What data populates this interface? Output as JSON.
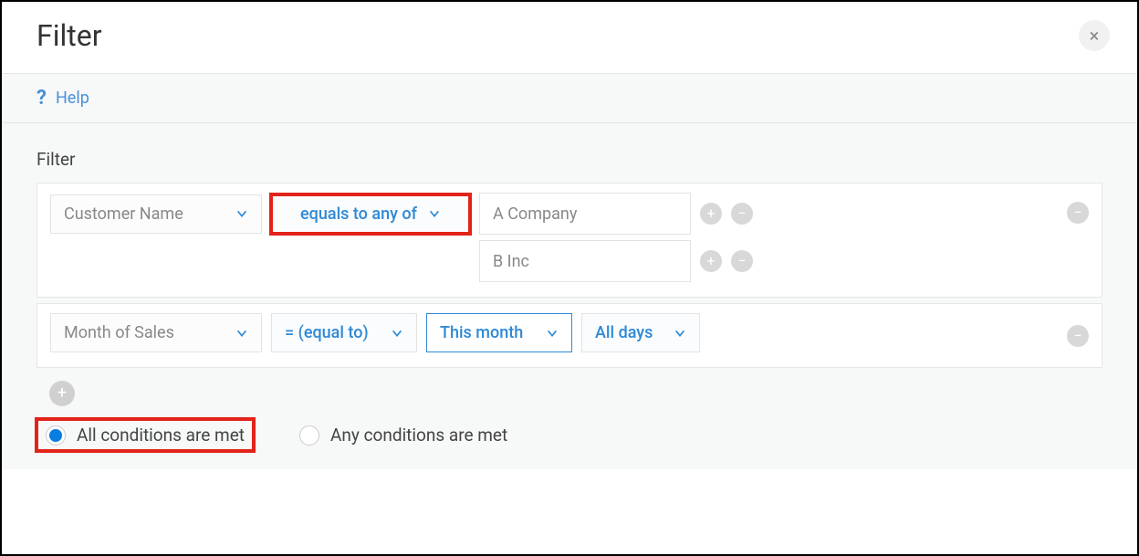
{
  "dialog": {
    "title": "Filter",
    "close": "×"
  },
  "help": {
    "label": "Help",
    "icon": "?"
  },
  "filter": {
    "section_label": "Filter",
    "block1": {
      "field": "Customer Name",
      "operator": "equals to any of",
      "values": [
        "A Company",
        "B Inc"
      ]
    },
    "block2": {
      "field": "Month of Sales",
      "operator": "= (equal to)",
      "period": "This month",
      "days": "All days"
    }
  },
  "logic": {
    "all_label": "All conditions are met",
    "any_label": "Any conditions are met",
    "selected": "all"
  },
  "glyphs": {
    "plus": "+",
    "minus": "−"
  }
}
